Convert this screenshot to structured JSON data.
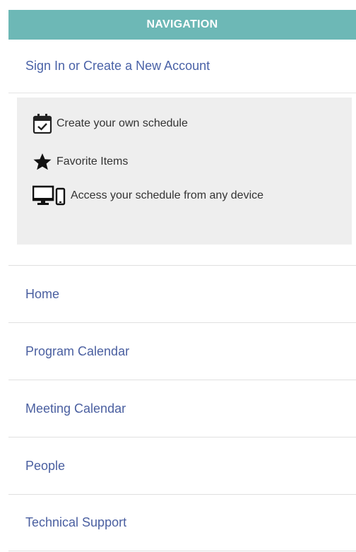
{
  "header": {
    "title": "NAVIGATION"
  },
  "signin": {
    "label": "Sign In or Create a New Account"
  },
  "promo": {
    "items": [
      {
        "icon": "calendar-check-icon",
        "text": "Create your own schedule"
      },
      {
        "icon": "star-icon",
        "text": "Favorite Items"
      },
      {
        "icon": "devices-icon",
        "text": "Access your schedule from any device"
      }
    ]
  },
  "menu": {
    "items": [
      {
        "label": "Home"
      },
      {
        "label": "Program Calendar"
      },
      {
        "label": "Meeting Calendar"
      },
      {
        "label": "People"
      },
      {
        "label": "Technical Support"
      }
    ]
  },
  "colors": {
    "header_bg": "#6db8b6",
    "link": "#4a62a7",
    "promo_bg": "#eeeeee"
  }
}
